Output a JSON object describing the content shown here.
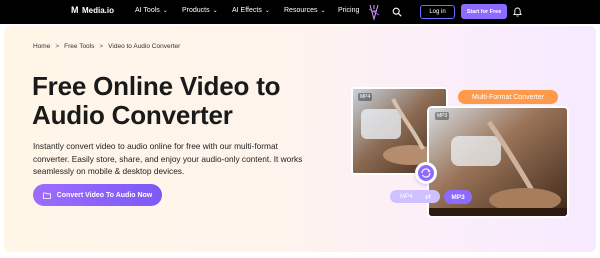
{
  "brand": {
    "logo_mark": "M",
    "name": "Media.io"
  },
  "nav": {
    "items": [
      {
        "label": "AI Tools",
        "has_dropdown": true
      },
      {
        "label": "Products",
        "has_dropdown": true
      },
      {
        "label": "AI Effects",
        "has_dropdown": true
      },
      {
        "label": "Resources",
        "has_dropdown": true
      },
      {
        "label": "Pricing",
        "has_dropdown": false
      }
    ],
    "chevron": "⌄",
    "login_label": "Log in",
    "start_label": "Start for Free",
    "icons": [
      "ai-decoration-icon",
      "search-icon",
      "bell-icon"
    ]
  },
  "breadcrumb": {
    "items": [
      "Home",
      "Free Tools",
      "Video to Audio Converter"
    ],
    "separator": ">"
  },
  "hero": {
    "title": "Free Online Video to Audio Converter",
    "description": "Instantly convert video to audio online for free with our multi-format converter. Easily store, share, and enjoy your audio-only content. It works seamlessly on mobile & desktop devices.",
    "cta_label": "Convert Video To Audio Now"
  },
  "illustration": {
    "badge": "Multi-Format Converter",
    "card_tag_a": "MP4",
    "card_tag_b": "MP3",
    "from_format": "MP4",
    "to_format": "MP3",
    "swap_glyph": "⇄"
  },
  "colors": {
    "nav_bg": "#000000",
    "accent_purple": "#8e6bff",
    "badge_orange": "#ff9a4a",
    "login_border": "#6b6bff"
  }
}
